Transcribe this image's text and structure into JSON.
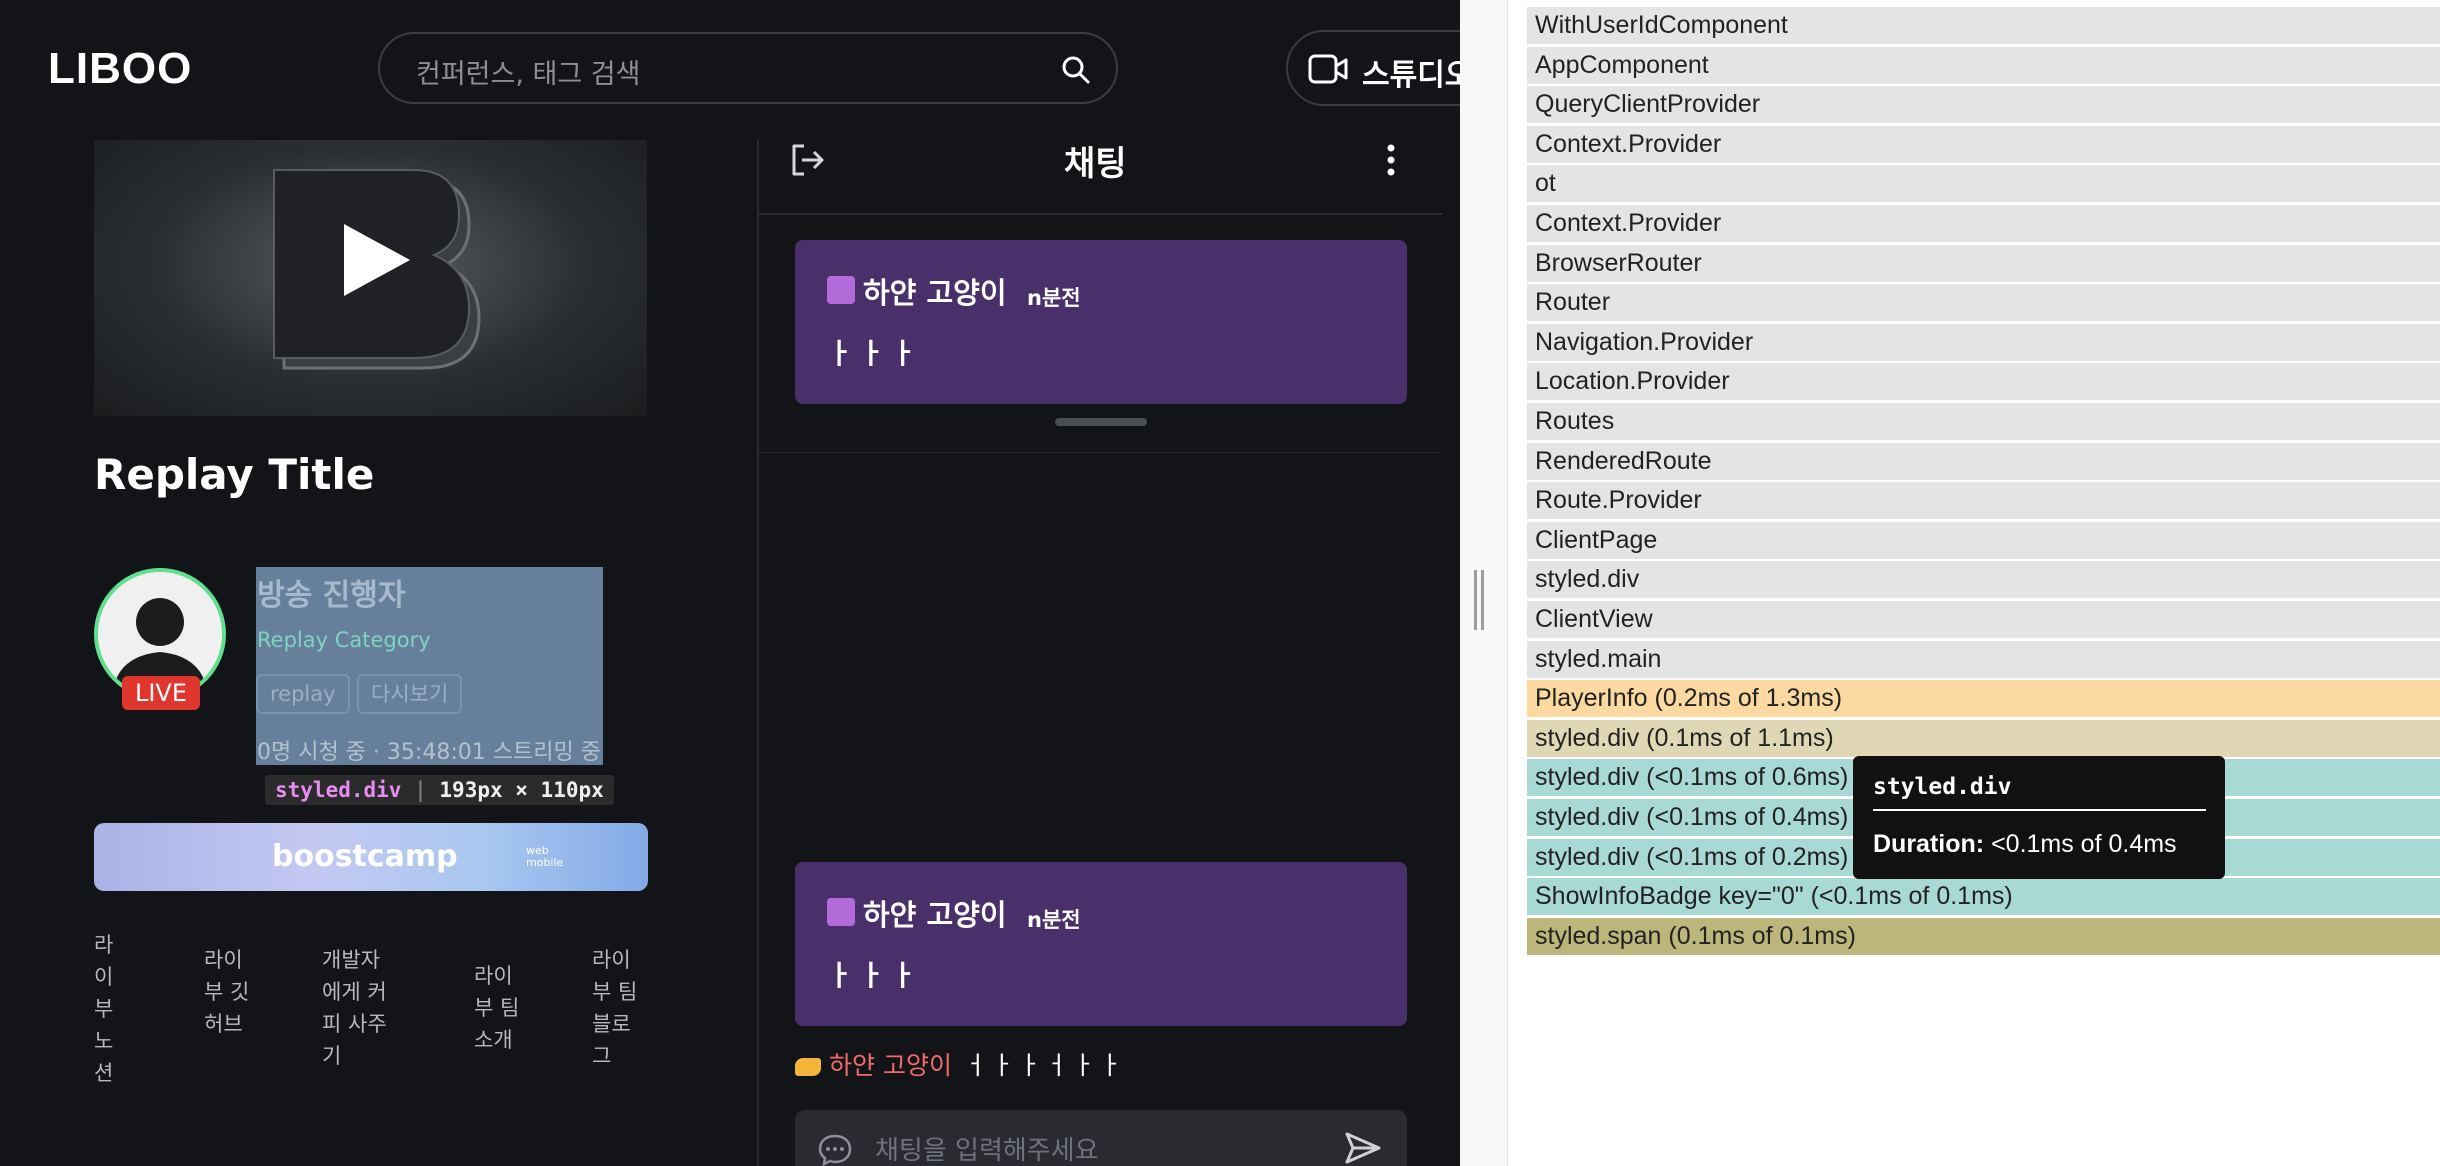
{
  "app": {
    "logo": "LIBOO",
    "search_placeholder": "컨퍼런스, 태그 검색",
    "studio_label": "스튜디오"
  },
  "player": {
    "title": "Replay Title",
    "host": "방송 진행자",
    "category": "Replay Category",
    "tags": [
      "replay",
      "다시보기"
    ],
    "live_badge": "LIVE",
    "viewers": "0명 시청 중 · 35:48:01 스트리밍 중"
  },
  "inspect_overlay": {
    "component": "styled.div",
    "separator": "|",
    "dims": "193px × 110px"
  },
  "banner": {
    "text": "boostcamp",
    "small_top": "web",
    "small_bottom": "mobile"
  },
  "footer": {
    "links": [
      "라이부노션",
      "라이부 깃허브",
      "개발자에게 커피 사주기",
      "라이부 팀 소개",
      "라이부 팀 블로그"
    ]
  },
  "chat": {
    "title": "채팅",
    "notices": [
      {
        "user": "하얀 고양이",
        "time": "n분전",
        "message": "ㅏㅏㅏ"
      },
      {
        "user": "하얀 고양이",
        "time": "n분전",
        "message": "ㅏㅏㅏ"
      }
    ],
    "message": {
      "user": "하얀 고양이",
      "text": "ㅓㅏㅏㅓㅏㅏ"
    },
    "input_placeholder": "채팅을  입력해주세요"
  },
  "devtools": {
    "flamegraph_rows": [
      {
        "label": "WithUserIdComponent",
        "color": "#e4e4e4"
      },
      {
        "label": "AppComponent",
        "color": "#e4e4e4"
      },
      {
        "label": "QueryClientProvider",
        "color": "#e4e4e4"
      },
      {
        "label": "Context.Provider",
        "color": "#e4e4e4"
      },
      {
        "label": "ot",
        "color": "#e4e4e4"
      },
      {
        "label": "Context.Provider",
        "color": "#e4e4e4"
      },
      {
        "label": "BrowserRouter",
        "color": "#e4e4e4"
      },
      {
        "label": "Router",
        "color": "#e4e4e4"
      },
      {
        "label": "Navigation.Provider",
        "color": "#e4e4e4"
      },
      {
        "label": "Location.Provider",
        "color": "#e4e4e4"
      },
      {
        "label": "Routes",
        "color": "#e4e4e4"
      },
      {
        "label": "RenderedRoute",
        "color": "#e4e4e4"
      },
      {
        "label": "Route.Provider",
        "color": "#e4e4e4"
      },
      {
        "label": "ClientPage",
        "color": "#e4e4e4"
      },
      {
        "label": "styled.div",
        "color": "#e4e4e4"
      },
      {
        "label": "ClientView",
        "color": "#e4e4e4"
      },
      {
        "label": "styled.main",
        "color": "#e4e4e4"
      },
      {
        "label": "PlayerInfo (0.2ms of 1.3ms)",
        "color": "#fbd9a1"
      },
      {
        "label": "styled.div (0.1ms of 1.1ms)",
        "color": "#e0d8b4"
      },
      {
        "label": "styled.div (<0.1ms of 0.6ms)",
        "color": "#a9d9d4"
      },
      {
        "label": "styled.div (<0.1ms of 0.4ms)",
        "color": "#a9d9d4"
      },
      {
        "label": "styled.div (<0.1ms of 0.2ms)",
        "color": "#a9d9d4"
      },
      {
        "label": "ShowInfoBadge key=\"0\" (<0.1ms of 0.1ms)",
        "color": "#a9d9d4"
      },
      {
        "label": "styled.span (0.1ms of 0.1ms)",
        "color": "#bdb67a"
      }
    ],
    "tooltip": {
      "name": "styled.div",
      "duration_label": "Duration:",
      "duration_value": "<0.1ms of 0.4ms"
    }
  }
}
